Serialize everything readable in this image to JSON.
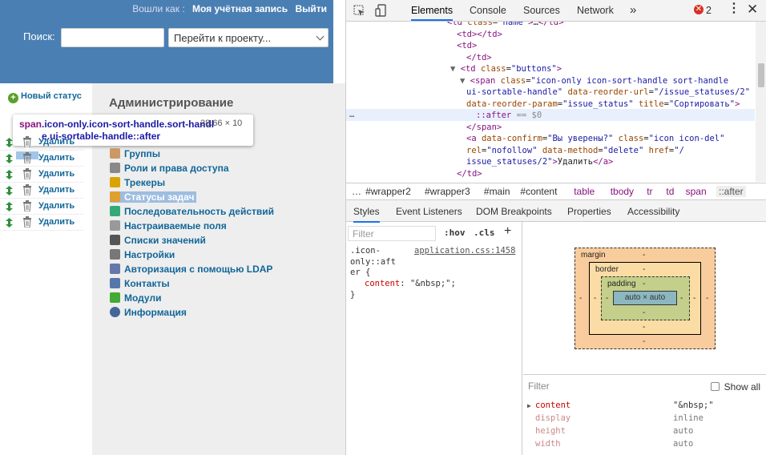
{
  "header": {
    "logged_as": "Вошли как :",
    "my_account": "Моя учётная запись",
    "logout": "Выйти",
    "search_label": "Поиск:",
    "search_value": "",
    "project_jump": "Перейти к проекту..."
  },
  "content": {
    "new_status": "Новый статус",
    "delete_label": "Удалить",
    "row_count": 6
  },
  "sidebar": {
    "title": "Администрирование",
    "items": [
      {
        "label": "Группы",
        "icon": "group-icon"
      },
      {
        "label": "Роли и права доступа",
        "icon": "lock-icon"
      },
      {
        "label": "Трекеры",
        "icon": "ticket-icon"
      },
      {
        "label": "Статусы задач",
        "icon": "status-icon",
        "selected": true
      },
      {
        "label": "Последовательность действий",
        "icon": "workflow-icon"
      },
      {
        "label": "Настраиваемые поля",
        "icon": "custom-fields-icon"
      },
      {
        "label": "Списки значений",
        "icon": "list-icon"
      },
      {
        "label": "Настройки",
        "icon": "gear-icon"
      },
      {
        "label": "Авторизация с помощью LDAP",
        "icon": "server-icon"
      },
      {
        "label": "Контакты",
        "icon": "contacts-icon"
      },
      {
        "label": "Модули",
        "icon": "plugin-icon"
      },
      {
        "label": "Информация",
        "icon": "info-icon"
      }
    ]
  },
  "tooltip": {
    "tag": "span",
    "classes": ".icon-only.icon-sort-handle.sort-handle.ui-sortable-handle::after",
    "dims": "28.66 × 10"
  },
  "devtools": {
    "tabs": [
      "Elements",
      "Console",
      "Sources",
      "Network"
    ],
    "active_tab": "Elements",
    "more": "»",
    "error_count": "2",
    "dom_lines": [
      {
        "indent": 0,
        "html": "<td class=\"name\">…</td>",
        "parts": [
          [
            "tg",
            "<td "
          ],
          [
            "at",
            "class"
          ],
          [
            "tx",
            "="
          ],
          [
            "av",
            "\"name\""
          ],
          [
            "tg",
            ">"
          ],
          [
            "tx",
            "…"
          ],
          [
            "tg",
            "</td>"
          ]
        ]
      },
      {
        "indent": 1,
        "parts": [
          [
            "tg",
            "<td></td>"
          ]
        ]
      },
      {
        "indent": 1,
        "parts": [
          [
            "tg",
            "<td>"
          ]
        ]
      },
      {
        "indent": 2,
        "parts": [
          [
            "tg",
            "</td>"
          ]
        ]
      },
      {
        "indent": 1,
        "tri": "▼",
        "parts": [
          [
            "tg",
            "<td "
          ],
          [
            "at",
            "class"
          ],
          [
            "tx",
            "="
          ],
          [
            "av",
            "\"buttons\""
          ],
          [
            "tg",
            ">"
          ]
        ]
      },
      {
        "indent": 2,
        "tri": "▼",
        "parts": [
          [
            "tg",
            "<span "
          ],
          [
            "at",
            "class"
          ],
          [
            "tx",
            "="
          ],
          [
            "av",
            "\"icon-only icon-sort-handle sort-handle"
          ]
        ]
      },
      {
        "indent": 2,
        "parts": [
          [
            "av",
            "ui-sortable-handle\" "
          ],
          [
            "at",
            "data-reorder-url"
          ],
          [
            "tx",
            "="
          ],
          [
            "av",
            "\"/issue_statuses/2\""
          ]
        ]
      },
      {
        "indent": 2,
        "parts": [
          [
            "at",
            "data-reorder-param"
          ],
          [
            "tx",
            "="
          ],
          [
            "av",
            "\"issue_status\" "
          ],
          [
            "at",
            "title"
          ],
          [
            "tx",
            "="
          ],
          [
            "av",
            "\"Сортировать\""
          ],
          [
            "tg",
            ">"
          ]
        ]
      },
      {
        "indent": 3,
        "parts": [
          [
            "tg",
            "::after"
          ],
          [
            "cm",
            " == $0"
          ]
        ]
      },
      {
        "indent": 2,
        "parts": [
          [
            "tg",
            "</span>"
          ]
        ]
      },
      {
        "indent": 2,
        "parts": [
          [
            "tg",
            "<a "
          ],
          [
            "at",
            "data-confirm"
          ],
          [
            "tx",
            "="
          ],
          [
            "av",
            "\"Вы уверены?\" "
          ],
          [
            "at",
            "class"
          ],
          [
            "tx",
            "="
          ],
          [
            "av",
            "\"icon icon-del\""
          ]
        ]
      },
      {
        "indent": 2,
        "parts": [
          [
            "at",
            "rel"
          ],
          [
            "tx",
            "="
          ],
          [
            "av",
            "\"nofollow\" "
          ],
          [
            "at",
            "data-method"
          ],
          [
            "tx",
            "="
          ],
          [
            "av",
            "\"delete\" "
          ],
          [
            "at",
            "href"
          ],
          [
            "tx",
            "="
          ],
          [
            "av",
            "\"/"
          ]
        ]
      },
      {
        "indent": 2,
        "parts": [
          [
            "av",
            "issue_statuses/2\""
          ],
          [
            "tg",
            ">"
          ],
          [
            "tx",
            "Удалить"
          ],
          [
            "tg",
            "</a>"
          ]
        ]
      },
      {
        "indent": 1,
        "parts": [
          [
            "tg",
            "</td>"
          ]
        ]
      }
    ],
    "dots": "…",
    "crumbs": [
      "…",
      "#wrapper2",
      "#wrapper3",
      "#main",
      "#content",
      "table",
      "tbody",
      "tr",
      "td",
      "span",
      "::after"
    ],
    "sub_tabs": [
      "Styles",
      "Event Listeners",
      "DOM Breakpoints",
      "Properties",
      "Accessibility"
    ],
    "filter_placeholder": "Filter",
    "hov": ":hov",
    "cls": ".cls",
    "plus": "+",
    "rule_selector": ".icon-only::after {",
    "rule_selector_lines": [
      ".icon-",
      "only::aft",
      "er {"
    ],
    "rule_source": "application.css:1458",
    "rule_prop": "content",
    "rule_value": "\"&nbsp;\";",
    "rule_close": "}",
    "box_model": {
      "margin": "margin",
      "border": "border",
      "padding": "padding",
      "content": "auto × auto",
      "dash": "-"
    },
    "computed_filter": "Filter",
    "show_all": "Show all",
    "computed": [
      {
        "prop": "content",
        "value": "\"&nbsp;\"",
        "expand": true
      },
      {
        "prop": "display",
        "value": "inline"
      },
      {
        "prop": "height",
        "value": "auto"
      },
      {
        "prop": "width",
        "value": "auto"
      }
    ]
  }
}
